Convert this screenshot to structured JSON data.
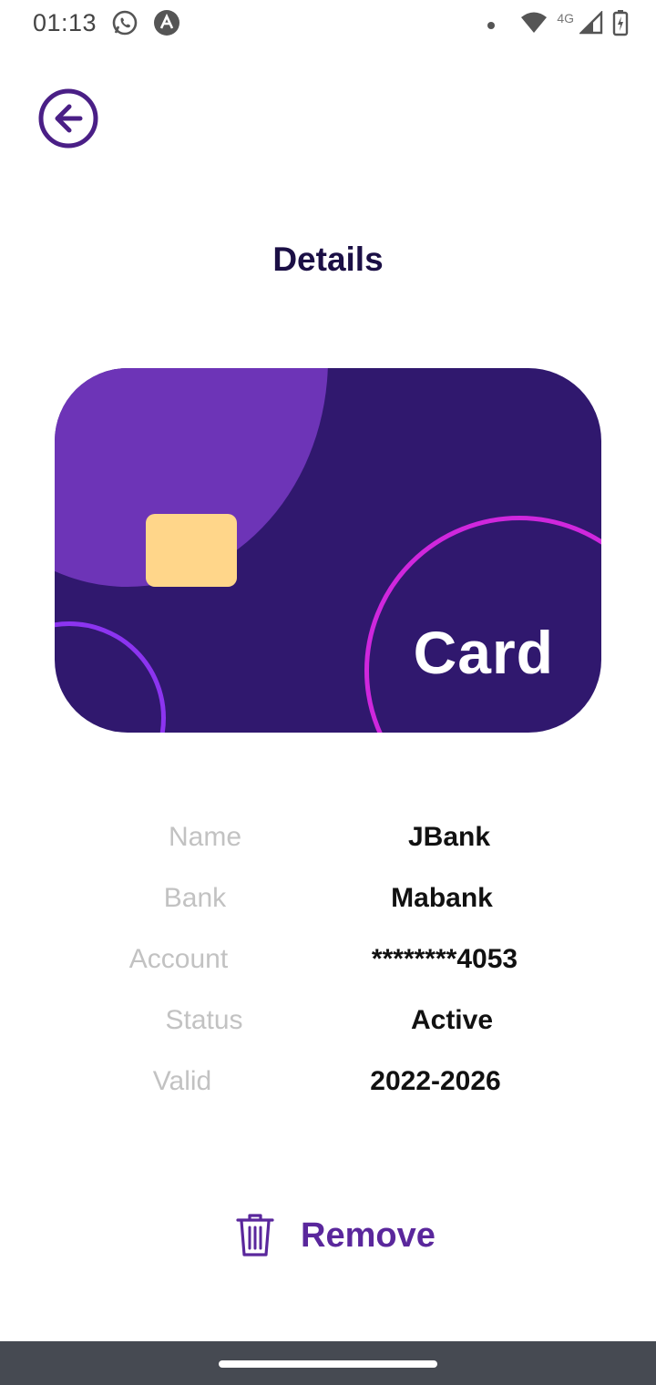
{
  "status_bar": {
    "time": "01:13",
    "network_type": "4G",
    "icons": [
      "whatsapp-icon",
      "app-icon",
      "notification-dot",
      "wifi-icon",
      "signal-icon",
      "battery-charging-icon"
    ]
  },
  "header": {
    "back_icon": "back-arrow-icon",
    "title": "Details"
  },
  "card": {
    "label": "Card",
    "colors": {
      "background": "#30186e",
      "blob": "#6d34b7",
      "chip": "#ffd68a",
      "ring_small": "#8c34f0",
      "ring_large": "#cf27dd"
    }
  },
  "details": [
    {
      "label": "Name",
      "value": "JBank"
    },
    {
      "label": "Bank",
      "value": "Mabank"
    },
    {
      "label": "Account",
      "value": "********4053"
    },
    {
      "label": "Status",
      "value": "Active"
    },
    {
      "label": "Valid",
      "value": "2022-2026"
    }
  ],
  "actions": {
    "remove_label": "Remove",
    "remove_icon": "trash-icon",
    "accent": "#5a279c"
  }
}
